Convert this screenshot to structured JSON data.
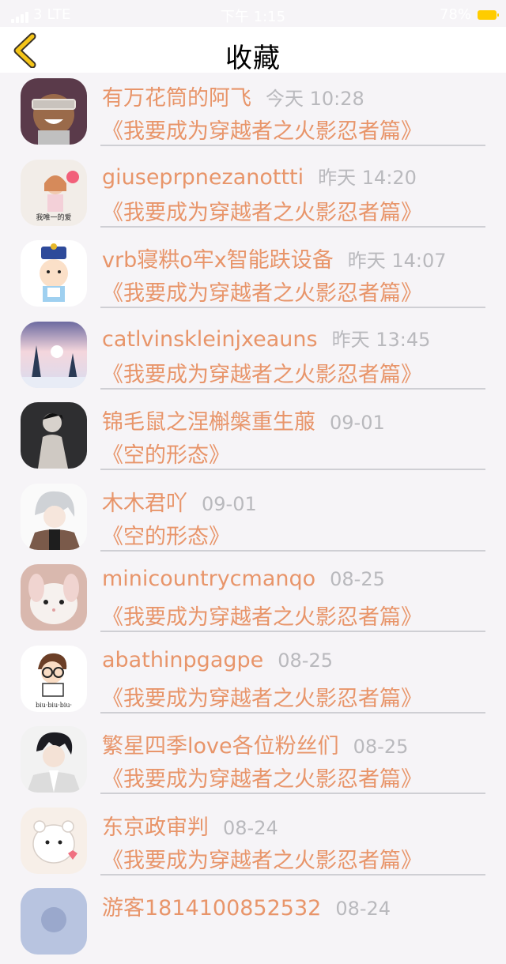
{
  "status_bar": {
    "carrier": "3",
    "network": "LTE",
    "time": "下午 1:15",
    "battery_percent": "78%",
    "battery_color": "#ffcc00"
  },
  "nav": {
    "title": "收藏",
    "back_icon": "chevron-left-icon",
    "accent_color": "#f5c518"
  },
  "items": [
    {
      "name": "有万花筒的阿飞",
      "time": "今天 10:28",
      "work": "《我要成为穿越者之火影忍者篇》",
      "avatar_caption": ""
    },
    {
      "name": "giuseprpnezanottti",
      "time": "昨天 14:20",
      "work": "《我要成为穿越者之火影忍者篇》",
      "avatar_caption": "我唯一的爱"
    },
    {
      "name": "vrb寝粠o牢x智能趺设备",
      "time": "昨天 14:07",
      "work": "《我要成为穿越者之火影忍者篇》",
      "avatar_caption": ""
    },
    {
      "name": "catlvinskleinjxeauns",
      "time": "昨天 13:45",
      "work": "《我要成为穿越者之火影忍者篇》",
      "avatar_caption": ""
    },
    {
      "name": "锦毛鼠之涅槲槃重生菔",
      "time": "09-01",
      "work": "《空的形态》",
      "avatar_caption": ""
    },
    {
      "name": "木木君吖",
      "time": "09-01",
      "work": "《空的形态》",
      "avatar_caption": ""
    },
    {
      "name": "minicountrycmanqo",
      "time": "08-25",
      "work": "《我要成为穿越者之火影忍者篇》",
      "avatar_caption": ""
    },
    {
      "name": "abathinpgagpe",
      "time": "08-25",
      "work": "《我要成为穿越者之火影忍者篇》",
      "avatar_caption": "biu·biu·biu·"
    },
    {
      "name": "繁星四季love各位粉丝们",
      "time": "08-25",
      "work": "《我要成为穿越者之火影忍者篇》",
      "avatar_caption": ""
    },
    {
      "name": "东京政审判",
      "time": "08-24",
      "work": "《我要成为穿越者之火影忍者篇》",
      "avatar_caption": ""
    },
    {
      "name": "游客1814100852532",
      "time": "08-24",
      "work": "",
      "avatar_caption": ""
    }
  ]
}
